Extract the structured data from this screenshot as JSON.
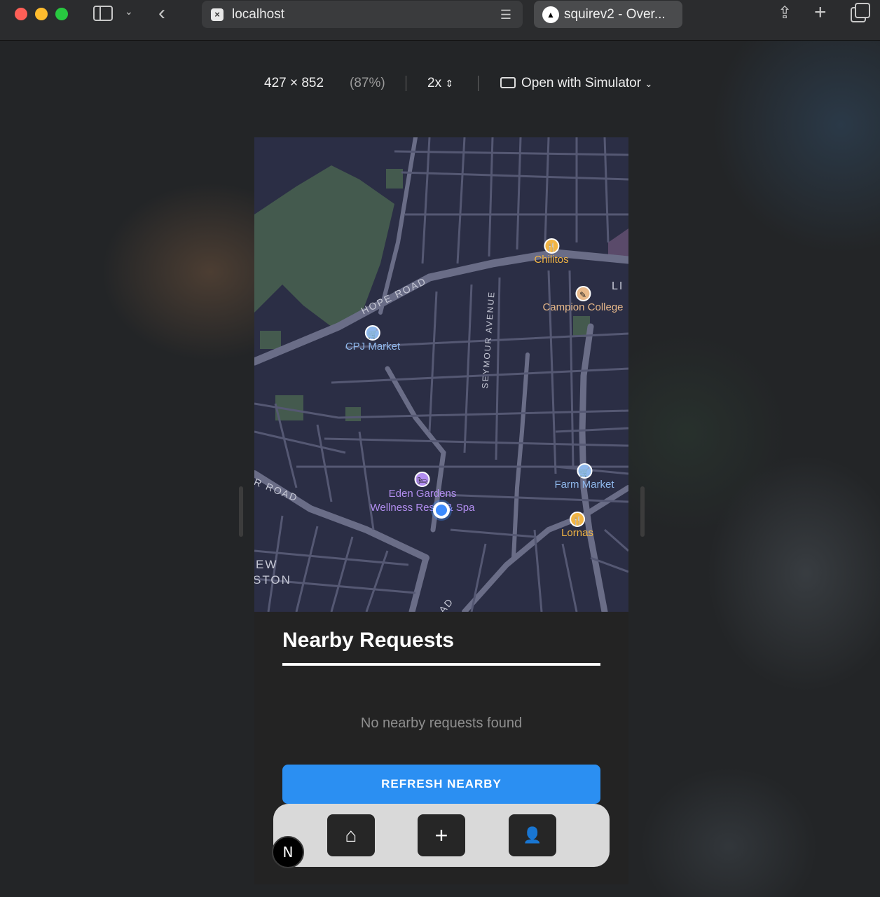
{
  "browser": {
    "url": "localhost",
    "tab_title": "squirev2 - Over...",
    "icons": [
      "sidebar-icon",
      "chevron-down-icon",
      "back-arrow-icon",
      "reader-icon",
      "share-icon",
      "new-tab-icon",
      "tabs-overview-icon"
    ]
  },
  "devtools": {
    "dimensions": "427 × 852",
    "zoom": "(87%)",
    "scale": "2x",
    "simulator_label": "Open with Simulator"
  },
  "map": {
    "road_labels": [
      "HOPE ROAD",
      "SEYMOUR AVENUE",
      "R ROAD",
      "EW",
      "STON",
      "AD",
      "LI"
    ],
    "pois": [
      {
        "label": "Chilitos",
        "type": "restaurant",
        "color": "#f2b544"
      },
      {
        "label": "Campion College",
        "type": "school",
        "color": "#e8b98a"
      },
      {
        "label": "CPJ Market",
        "type": "shop",
        "color": "#8fb8ec"
      },
      {
        "label": "Farm Market",
        "type": "shop",
        "color": "#8fb8ec"
      },
      {
        "label": "Lornas",
        "type": "restaurant",
        "color": "#f2b544"
      },
      {
        "label": "Eden Gardens",
        "label2": "Wellness Res",
        "label3": "& Spa",
        "type": "hotel",
        "color": "#b28ef0"
      }
    ]
  },
  "sheet": {
    "title": "Nearby Requests",
    "empty_message": "No nearby requests found",
    "refresh_label": "REFRESH NEARBY"
  },
  "tabbar": {
    "home_icon": "⌂",
    "add_icon": "+",
    "profile_icon": "👤",
    "badge": "N"
  },
  "colors": {
    "accent": "#2b8ff2",
    "map_bg": "#2b2e45",
    "road": "#5d6079"
  }
}
